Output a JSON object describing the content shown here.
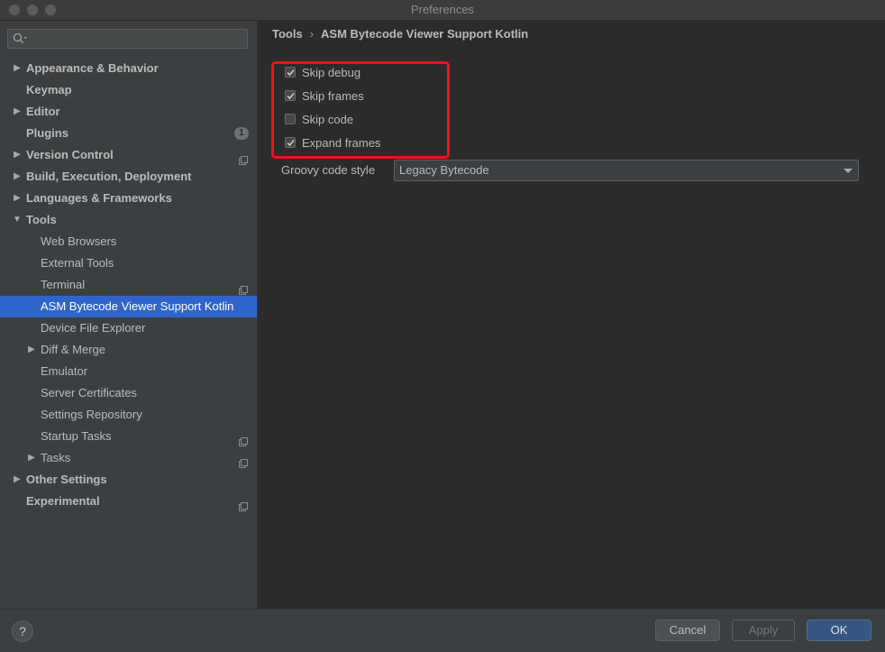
{
  "window": {
    "title": "Preferences"
  },
  "sidebar": {
    "search_placeholder": "",
    "items": [
      {
        "label": "Appearance & Behavior",
        "level": 0,
        "bold": true,
        "arrow": "right"
      },
      {
        "label": "Keymap",
        "level": 0,
        "bold": true,
        "arrow": ""
      },
      {
        "label": "Editor",
        "level": 0,
        "bold": true,
        "arrow": "right"
      },
      {
        "label": "Plugins",
        "level": 0,
        "bold": true,
        "arrow": "",
        "badge": "1"
      },
      {
        "label": "Version Control",
        "level": 0,
        "bold": true,
        "arrow": "right",
        "project": true
      },
      {
        "label": "Build, Execution, Deployment",
        "level": 0,
        "bold": true,
        "arrow": "right"
      },
      {
        "label": "Languages & Frameworks",
        "level": 0,
        "bold": true,
        "arrow": "right"
      },
      {
        "label": "Tools",
        "level": 0,
        "bold": true,
        "arrow": "down"
      },
      {
        "label": "Web Browsers",
        "level": 1,
        "bold": false,
        "arrow": ""
      },
      {
        "label": "External Tools",
        "level": 1,
        "bold": false,
        "arrow": ""
      },
      {
        "label": "Terminal",
        "level": 1,
        "bold": false,
        "arrow": "",
        "project": true
      },
      {
        "label": "ASM Bytecode Viewer Support Kotlin",
        "level": 1,
        "bold": false,
        "arrow": "",
        "selected": true
      },
      {
        "label": "Device File Explorer",
        "level": 1,
        "bold": false,
        "arrow": ""
      },
      {
        "label": "Diff & Merge",
        "level": 1,
        "bold": false,
        "arrow": "right"
      },
      {
        "label": "Emulator",
        "level": 1,
        "bold": false,
        "arrow": ""
      },
      {
        "label": "Server Certificates",
        "level": 1,
        "bold": false,
        "arrow": ""
      },
      {
        "label": "Settings Repository",
        "level": 1,
        "bold": false,
        "arrow": ""
      },
      {
        "label": "Startup Tasks",
        "level": 1,
        "bold": false,
        "arrow": "",
        "project": true
      },
      {
        "label": "Tasks",
        "level": 1,
        "bold": false,
        "arrow": "right",
        "project": true
      },
      {
        "label": "Other Settings",
        "level": 0,
        "bold": true,
        "arrow": "right"
      },
      {
        "label": "Experimental",
        "level": 0,
        "bold": true,
        "arrow": "",
        "project": true
      }
    ]
  },
  "content": {
    "breadcrumb": {
      "parent": "Tools",
      "separator": "›",
      "current": "ASM Bytecode Viewer Support Kotlin"
    },
    "options": [
      {
        "label": "Skip debug",
        "checked": true
      },
      {
        "label": "Skip frames",
        "checked": true
      },
      {
        "label": "Skip code",
        "checked": false
      },
      {
        "label": "Expand frames",
        "checked": true
      }
    ],
    "code_style": {
      "label": "Groovy code style",
      "value": "Legacy Bytecode"
    }
  },
  "footer": {
    "help_label": "?",
    "cancel_label": "Cancel",
    "apply_label": "Apply",
    "ok_label": "OK"
  },
  "colors": {
    "selection": "#2f65ca",
    "highlight_border": "#e8161a",
    "ok_button": "#365880"
  }
}
